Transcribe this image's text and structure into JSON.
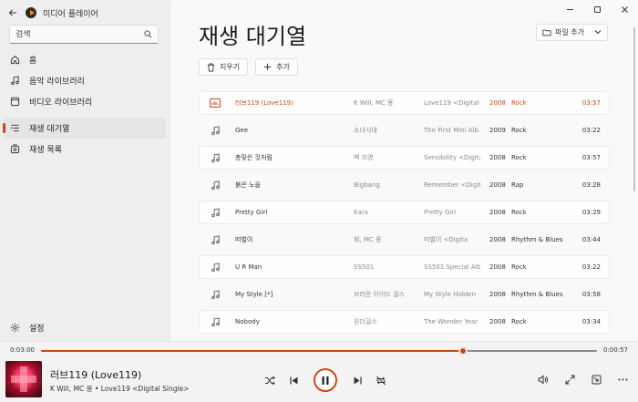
{
  "titlebar": {
    "app_name": "미디어 플레이어"
  },
  "search": {
    "placeholder": "검색"
  },
  "nav": [
    {
      "id": "home",
      "label": "홈",
      "icon": "home-icon"
    },
    {
      "id": "music-library",
      "label": "음악 라이브러리",
      "icon": "music-note-icon"
    },
    {
      "id": "video-library",
      "label": "비디오 라이브러리",
      "icon": "video-icon"
    },
    {
      "id": "now-playing",
      "label": "재생 대기열",
      "icon": "queue-icon",
      "active": true
    },
    {
      "id": "playlists",
      "label": "재생 목록",
      "icon": "playlist-icon"
    }
  ],
  "settings": {
    "label": "설정"
  },
  "main": {
    "title": "재생 대기열",
    "add_file_label": "파일 추가",
    "clear_label": "지우기",
    "add_label": "추가"
  },
  "queue": [
    {
      "title": "러브119 (Love119)",
      "artist": "K Will, MC 몽",
      "album": "Love119 <Digital",
      "year": "2008",
      "genre": "Rock",
      "duration": "03:57",
      "current": true
    },
    {
      "title": "Gee",
      "artist": "소녀시대",
      "album": "The First Mini Alb",
      "year": "2009",
      "genre": "Rock",
      "duration": "03:22"
    },
    {
      "title": "총맞은 것처럼",
      "artist": "백 지영",
      "album": "Sensibility <Digita",
      "year": "2008",
      "genre": "Rock",
      "duration": "03:57"
    },
    {
      "title": "붉은 노을",
      "artist": "Bigbang",
      "album": "Remember <Digit",
      "year": "2008",
      "genre": "Rap",
      "duration": "03:28"
    },
    {
      "title": "Pretty Girl",
      "artist": "Kara",
      "album": "Pretty Girl",
      "year": "2008",
      "genre": "Rock",
      "duration": "03:29"
    },
    {
      "title": "떠벌이",
      "artist": "휘, MC 몽",
      "album": "떠벌이 <Digita",
      "year": "2008",
      "genre": "Rhythm & Blues",
      "duration": "03:44"
    },
    {
      "title": "U R Man",
      "artist": "SS501",
      "album": "SS501 Special Alb",
      "year": "2008",
      "genre": "Rock",
      "duration": "03:22"
    },
    {
      "title": "My Style [*]",
      "artist": "브라운 아이드 걸스",
      "album": "My Style Hidden",
      "year": "2008",
      "genre": "Rhythm & Blues",
      "duration": "03:58"
    },
    {
      "title": "Nobody",
      "artist": "원더걸스",
      "album": "The Wonder Year",
      "year": "2008",
      "genre": "Rock",
      "duration": "03:34"
    }
  ],
  "player": {
    "elapsed": "0:03:00",
    "remaining": "0:00:57",
    "progress": 0.759,
    "title": "러브119 (Love119)",
    "subtitle": "K Will, MC 몽 • Love119 <Digital Single>"
  },
  "colors": {
    "accent": "#c74a16"
  }
}
